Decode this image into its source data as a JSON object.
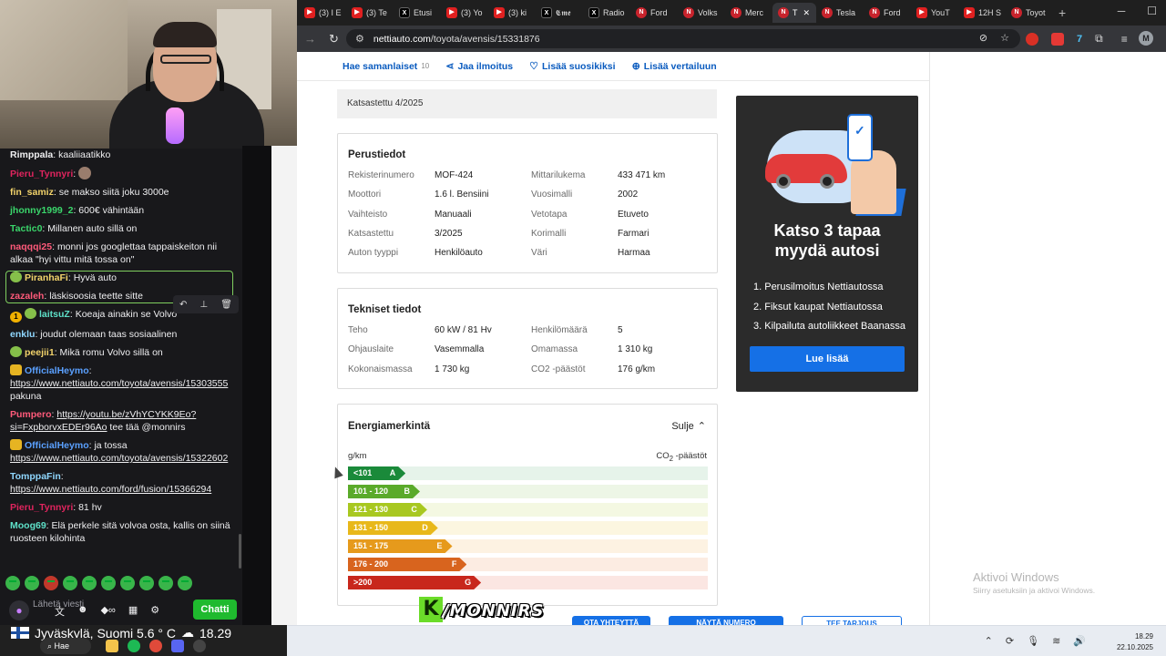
{
  "browser": {
    "tabs": [
      {
        "icon": "youtube-icon",
        "fav": "▶",
        "cls": "yt",
        "label": "(3) I E"
      },
      {
        "icon": "youtube-icon",
        "fav": "▶",
        "cls": "yt",
        "label": "(3) Te"
      },
      {
        "icon": "x-icon",
        "fav": "X",
        "cls": "x",
        "label": "Etusi"
      },
      {
        "icon": "youtube-icon",
        "fav": "▶",
        "cls": "yt",
        "label": "(3) Yo"
      },
      {
        "icon": "youtube-icon",
        "fav": "▶",
        "cls": "yt",
        "label": "(3) ki"
      },
      {
        "icon": "x-icon",
        "fav": "X",
        "cls": "x",
        "label": "𝕮𝖒𝖊"
      },
      {
        "icon": "x-icon",
        "fav": "X",
        "cls": "x",
        "label": "Radio"
      },
      {
        "icon": "nettiauto-icon",
        "fav": "N",
        "cls": "n",
        "label": "Ford"
      },
      {
        "icon": "nettiauto-icon",
        "fav": "N",
        "cls": "n",
        "label": "Volks"
      },
      {
        "icon": "nettiauto-icon",
        "fav": "N",
        "cls": "n",
        "label": "Merc"
      },
      {
        "icon": "nettiauto-icon",
        "fav": "N",
        "cls": "n",
        "label": "T",
        "active": true
      },
      {
        "icon": "nettiauto-icon",
        "fav": "N",
        "cls": "n",
        "label": "Tesla"
      },
      {
        "icon": "nettiauto-icon",
        "fav": "N",
        "cls": "n",
        "label": "Ford"
      },
      {
        "icon": "youtube-icon",
        "fav": "▶",
        "cls": "yt",
        "label": "YouT"
      },
      {
        "icon": "youtube-icon",
        "fav": "▶",
        "cls": "yt",
        "label": "12H S"
      },
      {
        "icon": "nettiauto-icon",
        "fav": "N",
        "cls": "n",
        "label": "Toyot"
      }
    ],
    "url_host": "nettiauto.com",
    "url_path": "/toyota/avensis/15331876"
  },
  "actions": {
    "similar": "Hae samanlaiset",
    "similar_count": "10",
    "share": "Jaa ilmoitus",
    "favorite": "Lisää suosikiksi",
    "compare": "Lisää vertailuun"
  },
  "inspected_note": "Katsastettu 4/2025",
  "basic": {
    "title": "Perustiedot",
    "rows": [
      [
        "Rekisterinumero",
        "MOF-424",
        "Mittarilukema",
        "433 471 km"
      ],
      [
        "Moottori",
        "1.6 l. Bensiini",
        "Vuosimalli",
        "2002"
      ],
      [
        "Vaihteisto",
        "Manuaali",
        "Vetotapa",
        "Etuveto"
      ],
      [
        "Katsastettu",
        "3/2025",
        "Korimalli",
        "Farmari"
      ],
      [
        "Auton tyyppi",
        "Henkilöauto",
        "Väri",
        "Harmaa"
      ]
    ]
  },
  "tech": {
    "title": "Tekniset tiedot",
    "rows": [
      [
        "Teho",
        "60 kW / 81 Hv",
        "Henkilömäärä",
        "5"
      ],
      [
        "Ohjauslaite",
        "Vasemmalla",
        "Omamassa",
        "1 310 kg"
      ],
      [
        "Kokonaismassa",
        "1 730 kg",
        "CO2 -päästöt",
        "176 g/km"
      ]
    ]
  },
  "energy": {
    "title": "Energiamerkintä",
    "toggle": "Sulje",
    "unit": "g/km",
    "co2_label": "CO",
    "co2_sub": "2",
    "co2_suffix": " -päästöt",
    "bars": [
      {
        "range": "<101",
        "cls": "A",
        "fill": 0.16,
        "color": "#1a8a3a",
        "track": "#e6f3ea"
      },
      {
        "range": "101 - 120",
        "cls": "B",
        "fill": 0.2,
        "color": "#5aaa2a",
        "track": "#edf6e6"
      },
      {
        "range": "121 - 130",
        "cls": "C",
        "fill": 0.22,
        "color": "#a8c820",
        "track": "#f4f8e2"
      },
      {
        "range": "131 - 150",
        "cls": "D",
        "fill": 0.25,
        "color": "#e8b81a",
        "track": "#fcf6e0"
      },
      {
        "range": "151 - 175",
        "cls": "E",
        "fill": 0.29,
        "color": "#e69a1c",
        "track": "#fdf2e2"
      },
      {
        "range": "176 - 200",
        "cls": "F",
        "fill": 0.33,
        "color": "#d8641e",
        "track": "#fcece2"
      },
      {
        "range": ">200",
        "cls": "G",
        "fill": 0.37,
        "color": "#c8271c",
        "track": "#fbe6e2"
      }
    ]
  },
  "ad": {
    "title_line1": "Katso 3 tapaa",
    "title_line2": "myydä autosi",
    "items": [
      "1. Perusilmoitus Nettiautossa",
      "2. Fiksut kaupat Nettiautossa",
      "3. Kilpailuta autoliikkeet Baanassa"
    ],
    "button": "Lue lisää"
  },
  "windows_activation": {
    "title": "Aktivoi Windows",
    "subtitle": "Siirry asetuksiin ja aktivoi Windows."
  },
  "bottom_buttons": [
    "OTA YHTEYTTÄ",
    "NÄYTÄ NUMERO",
    "TEE TARJOUS"
  ],
  "overlay_logo": {
    "letter": "K",
    "text": "/MONNIRS"
  },
  "chat": {
    "messages": [
      {
        "user": "Rimppala",
        "color": "#efeff1",
        "text": "kaaliiaatikko"
      },
      {
        "user": "Pieru_Tynnyri",
        "color": "#e0245e",
        "text": "",
        "badge": "avatar"
      },
      {
        "user": "fin_samiz",
        "color": "#f2d36b",
        "text": "se makso siitä joku 3000e"
      },
      {
        "user": "jhonny1999_2",
        "color": "#3ad66b",
        "text": "600€ vähintään"
      },
      {
        "user": "Tactic0",
        "color": "#3ad66b",
        "text": "Millanen auto sillä on"
      },
      {
        "user": "naqqqi25",
        "color": "#ff5a7a",
        "text": "monni jos googlettaa tappaiskeiton nii alkaa \"hyi vittu mitä tossa on\""
      },
      {
        "user": "PiranhaFi",
        "color": "#f2d36b",
        "text": "Hyvä auto",
        "badge": "pine"
      },
      {
        "user": "zazaleh",
        "color": "#ff5a7a",
        "text": "läskisoosia teette sitte"
      },
      {
        "user": "laitsuZ",
        "color": "#5ee0c8",
        "text": "Koeaja ainakin se Volvo",
        "badge": "coin"
      },
      {
        "user": "enklu",
        "color": "#8fd7ff",
        "text": "joudut olemaan taas sosiaalinen"
      },
      {
        "user": "peejii1",
        "color": "#f2d36b",
        "text": "Mikä romu Volvo sillä on",
        "badge": "pine"
      },
      {
        "user": "OfficialHeymo",
        "color": "#5aa0ff",
        "text": "",
        "link": "https://www.nettiauto.com/toyota/avensis/15303555",
        "after": "pakuna",
        "badge": "crown"
      },
      {
        "user": "Pumpero",
        "color": "#ff5a7a",
        "text": "",
        "link": "https://youtu.be/zVhYCYKK9Eo?si=FxpborvxEDEr96Ao",
        "after": " tee tää @monnirs"
      },
      {
        "user": "OfficialHeymo",
        "color": "#5aa0ff",
        "text": "ja tossa",
        "link2": "https://www.nettiauto.com/toyota/avensis/15322602",
        "badge": "crown"
      },
      {
        "user": "TomppaFin",
        "color": "#8fd7ff",
        "text": "",
        "link2": "https://www.nettiauto.com/ford/fusion/15366294"
      },
      {
        "user": "Pieru_Tynnyri",
        "color": "#e0245e",
        "text": "81 hv"
      },
      {
        "user": "Moog69",
        "color": "#5ee0c8",
        "text": "Elä perkele sitä volvoa osta, kallis on siinä ruosteen kilohinta"
      }
    ],
    "input_placeholder": "Lähetä viesti",
    "send_label": "Chatti"
  },
  "taskbar": {
    "weather": "Jyväskylä, Suomi   5.6 ° C",
    "weather_time": "18.29",
    "search": "Hae",
    "time": "18.29",
    "date": "22.10.2025"
  }
}
